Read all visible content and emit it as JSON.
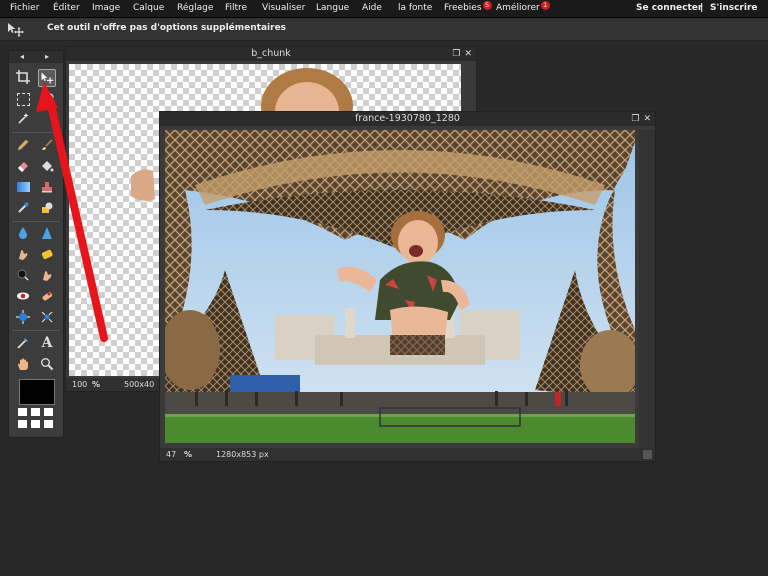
{
  "menu": {
    "items": [
      {
        "label": "Fichier"
      },
      {
        "label": "Éditer"
      },
      {
        "label": "Image"
      },
      {
        "label": "Calque"
      },
      {
        "label": "Réglage"
      },
      {
        "label": "Filtre"
      },
      {
        "label": "Visualiser"
      },
      {
        "label": "Langue"
      },
      {
        "label": "Aide"
      },
      {
        "label": "la fonte"
      },
      {
        "label": "Freebies",
        "badge": "5"
      },
      {
        "label": "Améliorer",
        "badge": "1"
      }
    ],
    "login": "Se connecter",
    "separator": "|",
    "signup": "S'inscrire"
  },
  "options": {
    "message": "Cet outil n'offre pas d'options supplémentaires"
  },
  "tools": {
    "left_arrow": "◂",
    "right_arrow": "▸",
    "foreground_color": "#000000"
  },
  "window_back": {
    "title": "b_chunk",
    "zoom": "100",
    "zoom_unit": "%",
    "size": "500x40"
  },
  "window_front": {
    "title": "france-1930780_1280",
    "zoom": "47",
    "zoom_unit": "%",
    "size": "1280x853 px"
  },
  "colors": {
    "arrow": "#e8141b",
    "badge": "#d31d1d"
  }
}
